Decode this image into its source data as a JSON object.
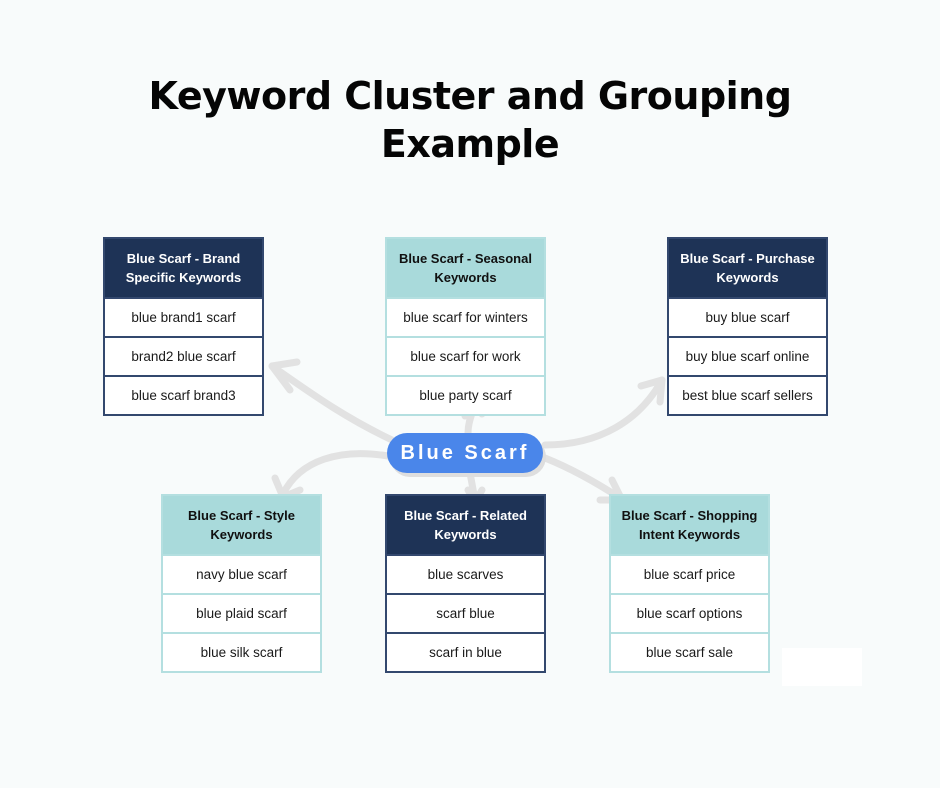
{
  "title": {
    "line1": "Keyword Cluster and Grouping",
    "line2": "Example"
  },
  "center": {
    "label": "Blue Scarf",
    "color": "#4a86ea"
  },
  "colors": {
    "dark_header": "#1e3356",
    "light_header": "#a9dadb",
    "arrow": "#e2e2e2"
  },
  "clusters": [
    {
      "header": "Blue Scarf - Brand Specific Keywords",
      "style": "dark",
      "keywords": [
        "blue brand1 scarf",
        "brand2 blue scarf",
        "blue scarf brand3"
      ]
    },
    {
      "header": "Blue Scarf - Seasonal Keywords",
      "style": "light",
      "keywords": [
        "blue scarf for winters",
        "blue scarf for work",
        "blue party scarf"
      ]
    },
    {
      "header": "Blue Scarf - Purchase Keywords",
      "style": "dark",
      "keywords": [
        "buy blue scarf",
        "buy blue scarf online",
        "best blue scarf sellers"
      ]
    },
    {
      "header": "Blue Scarf - Style Keywords",
      "style": "light",
      "keywords": [
        "navy blue scarf",
        "blue plaid scarf",
        "blue silk scarf"
      ]
    },
    {
      "header": "Blue Scarf - Related Keywords",
      "style": "dark",
      "keywords": [
        "blue scarves",
        "scarf blue",
        "scarf in blue"
      ]
    },
    {
      "header": "Blue Scarf -  Shopping Intent Keywords",
      "style": "light",
      "keywords": [
        "blue scarf price",
        "blue scarf options",
        "blue scarf sale"
      ]
    }
  ]
}
